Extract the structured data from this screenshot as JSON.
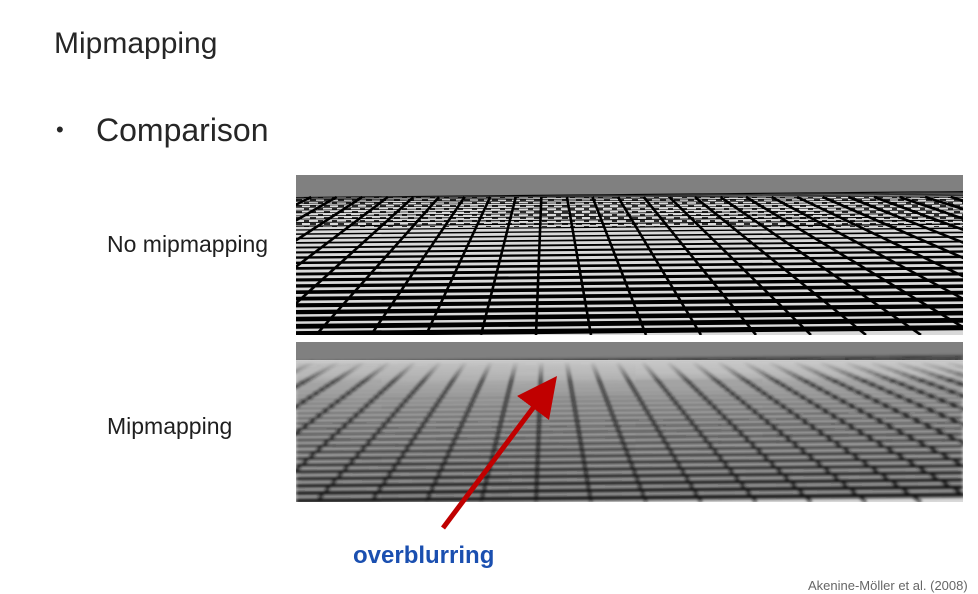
{
  "slide": {
    "title": "Mipmapping",
    "bullet": "Comparison"
  },
  "rows": {
    "top_label": "No mipmapping",
    "bottom_label": "Mipmapping"
  },
  "annotation": "overblurring",
  "citation": "Akenine-Möller et al. (2008)",
  "colors": {
    "annotation_text": "#1a4fb0",
    "arrow": "#c00000",
    "sky": "#808080",
    "tile": "#d9d9d9",
    "grid_line": "#000000"
  }
}
